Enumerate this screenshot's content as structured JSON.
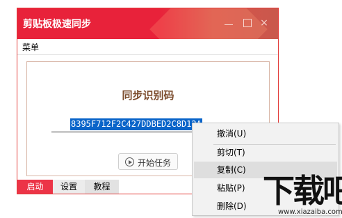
{
  "window": {
    "title": "剪贴板极速同步",
    "controls": {
      "minimize": "minimize",
      "maximize": "maximize",
      "close": "×"
    }
  },
  "menubar": {
    "menu_label": "菜单"
  },
  "main": {
    "heading": "同步识别码",
    "code_value": "8395F712F2C427DDBED2C8D12A",
    "start_button_label": "开始任务"
  },
  "tabs": [
    {
      "label": "启动",
      "active": true
    },
    {
      "label": "设置",
      "active": false
    },
    {
      "label": "教程",
      "active": false
    }
  ],
  "context_menu": {
    "items": [
      {
        "label": "撤消(U)",
        "highlighted": false
      },
      {
        "label": "剪切(T)",
        "highlighted": false
      },
      {
        "label": "复制(C)",
        "highlighted": true
      },
      {
        "label": "粘贴(P)",
        "highlighted": false
      },
      {
        "label": "删除(D)",
        "highlighted": false
      }
    ]
  },
  "watermark": {
    "logo_text": "下载吧",
    "url": "www.xiazaiba.com"
  },
  "colors": {
    "accent": "#e8223a",
    "selection": "#0a64c9",
    "heading": "#7a4a2a"
  }
}
